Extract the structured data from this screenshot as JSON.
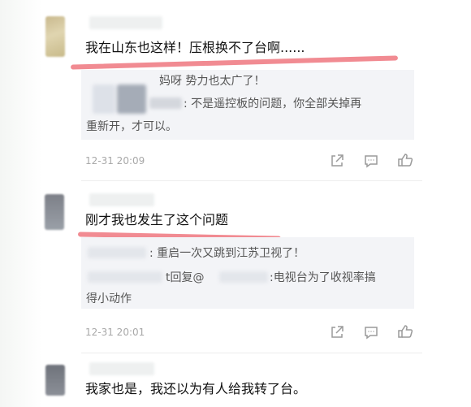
{
  "comments": [
    {
      "text": "我在山东也这样！压根换不了台啊......",
      "replies": [
        "妈呀 势力也太广了！",
        ": 不是遥控板的问题，你全部关掉再",
        "重新开，才可以。"
      ],
      "timestamp": "12-31 20:09",
      "icon_forward": "share-icon",
      "icon_comment": "comment-icon",
      "icon_like": "thumbs-up-icon"
    },
    {
      "text": "刚才我也发生了这个问题",
      "replies": [
        ": 重启一次又跳到江苏卫视了！",
        "t回复@",
        ":电视台为了收视率搞",
        "得小动作"
      ],
      "timestamp": "12-31 20:01",
      "icon_forward": "share-icon",
      "icon_comment": "comment-icon",
      "icon_like": "thumbs-up-icon"
    },
    {
      "text": "我家也是，我还以为有人给我转了台。"
    }
  ],
  "colors": {
    "underline": "#f07e86",
    "reply_bg": "#f3f4f7",
    "timestamp": "#a8a8a8",
    "icon": "#9a9a9a"
  }
}
